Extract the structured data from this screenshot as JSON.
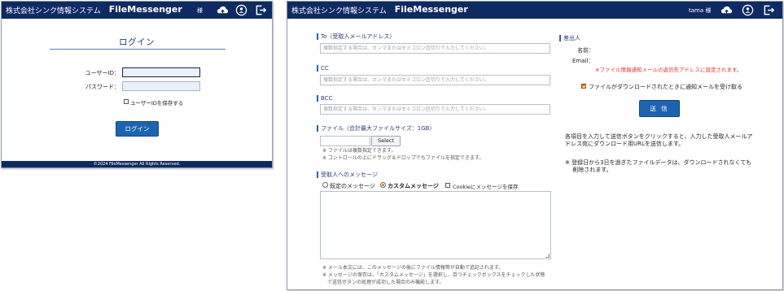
{
  "header": {
    "company": "株式会社シンク情報システム",
    "app_name": "FileMessenger",
    "login_user_suffix": "様",
    "send_user": "tama 様",
    "icons": [
      "upload-cloud-icon",
      "user-info-icon",
      "logout-icon"
    ]
  },
  "login": {
    "title": "ログイン",
    "userid_label": "ユーザーID：",
    "userid_value": "",
    "password_label": "パスワード：",
    "password_value": "",
    "remember_label": "ユーザーIDを保存する",
    "remember_checked": false,
    "button": "ログイン",
    "footer": "©2024 FileMessenger All Rights Reserved."
  },
  "send": {
    "to": {
      "label": "To（受取人メールアドレス）",
      "placeholder": "複数指定する場合は、カンマまたはセミコロン区切りで入力してください。"
    },
    "cc": {
      "label": "CC",
      "placeholder": "複数指定する場合は、カンマまたはセミコロン区切りで入力してください。"
    },
    "bcc": {
      "label": "BCC",
      "placeholder": "複数指定する場合は、カンマまたはセミコロン区切りで入力してください。"
    },
    "file": {
      "label": "ファイル（合計最大ファイルサイズ：1GB）",
      "select_button": "Select",
      "notes": [
        "※ ファイルは複数指定できます。",
        "※ コントロールの上にドラッグ＆ドロップでもファイルを指定できます。"
      ]
    },
    "message": {
      "label": "受取人へのメッセージ",
      "option_fixed": "既定のメッセージ",
      "option_custom": "カスタムメッセージ",
      "selected": "カスタムメッセージ",
      "cookie_label": "Cookieにメッセージを保存",
      "cookie_checked": false,
      "value": "",
      "notes": [
        "※ メール本文には、このメッセージの後にファイル情報等が自動で追記されます。",
        "※ メッセージの保存は、「カスタムメッセージ」を選択し、且つチェックボックスをチェックした状態",
        "　で送信ボタンの処理が成功した場合のみ機能します。"
      ]
    },
    "sender": {
      "label": "差出人",
      "name_label": "名前：",
      "email_label": "Email：",
      "warning": "※ファイル情報通知メールの返信先アドレスに設定されます。"
    },
    "notify_label": "ファイルがダウンロードされたときに通知メールを受け取る",
    "notify_checked": true,
    "send_button": "送 信",
    "info": [
      "各項目を入力して送信ボタンをクリックすると、入力した受取人メールア",
      "ドレス宛にダウンロード用URLを送信します。"
    ],
    "expiry_note": [
      "※ 登録日から3日を過ぎたファイルデータは、ダウンロードされなくても",
      "　 削除されます。"
    ]
  },
  "colors": {
    "header_bg": "#0e2a63",
    "button_bg": "#1d64b0",
    "warning": "#e03030",
    "accent_check": "#e07a10"
  }
}
